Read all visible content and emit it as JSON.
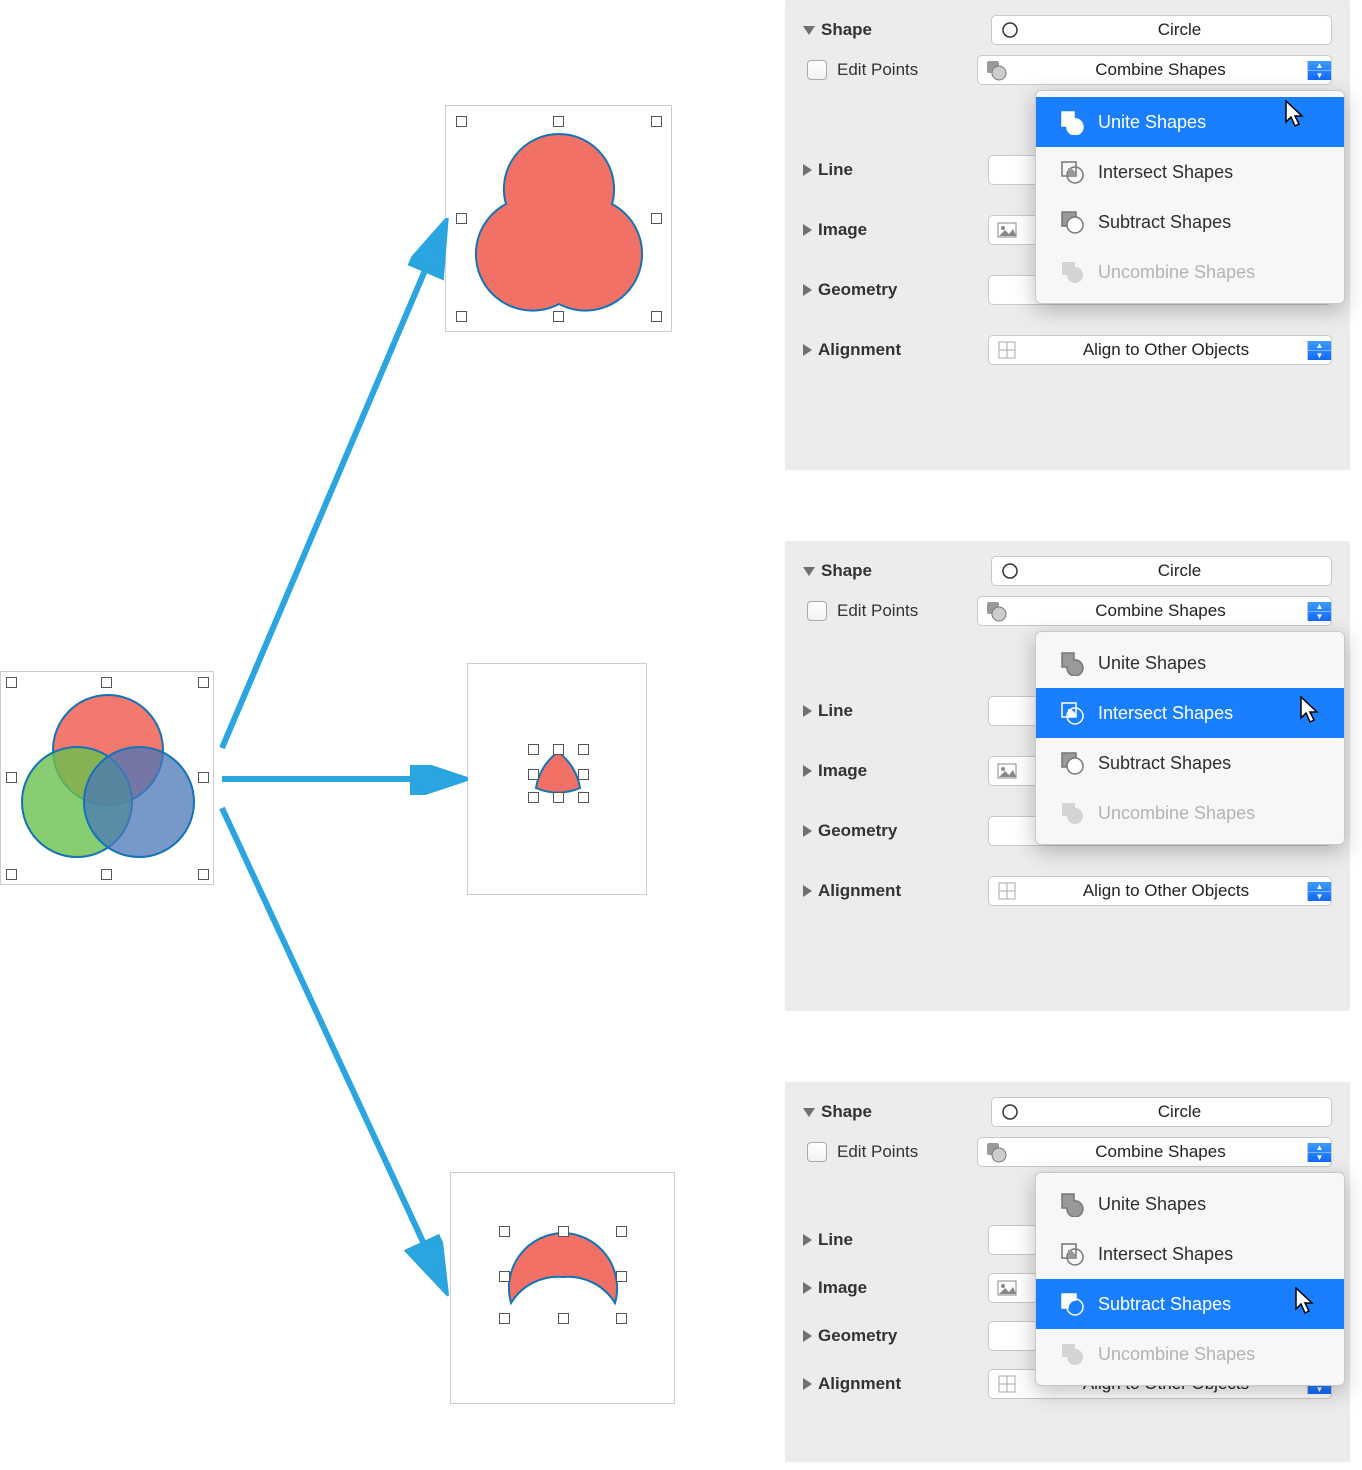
{
  "source": {
    "description": "three overlapping circles (red, green, blue)"
  },
  "results": {
    "unite": "union shape",
    "intersect": "small intersection shape",
    "subtract": "arc shape"
  },
  "inspector": {
    "shape": "Shape",
    "shape_value": "Circle",
    "edit_points": "Edit Points",
    "combine_button": "Combine Shapes",
    "line": "Line",
    "image": "Image",
    "geometry": "Geometry",
    "alignment": "Alignment",
    "alignment_value": "Align to Other Objects"
  },
  "menu": {
    "unite": "Unite Shapes",
    "intersect": "Intersect Shapes",
    "subtract": "Subtract Shapes",
    "uncombine": "Uncombine Shapes"
  }
}
